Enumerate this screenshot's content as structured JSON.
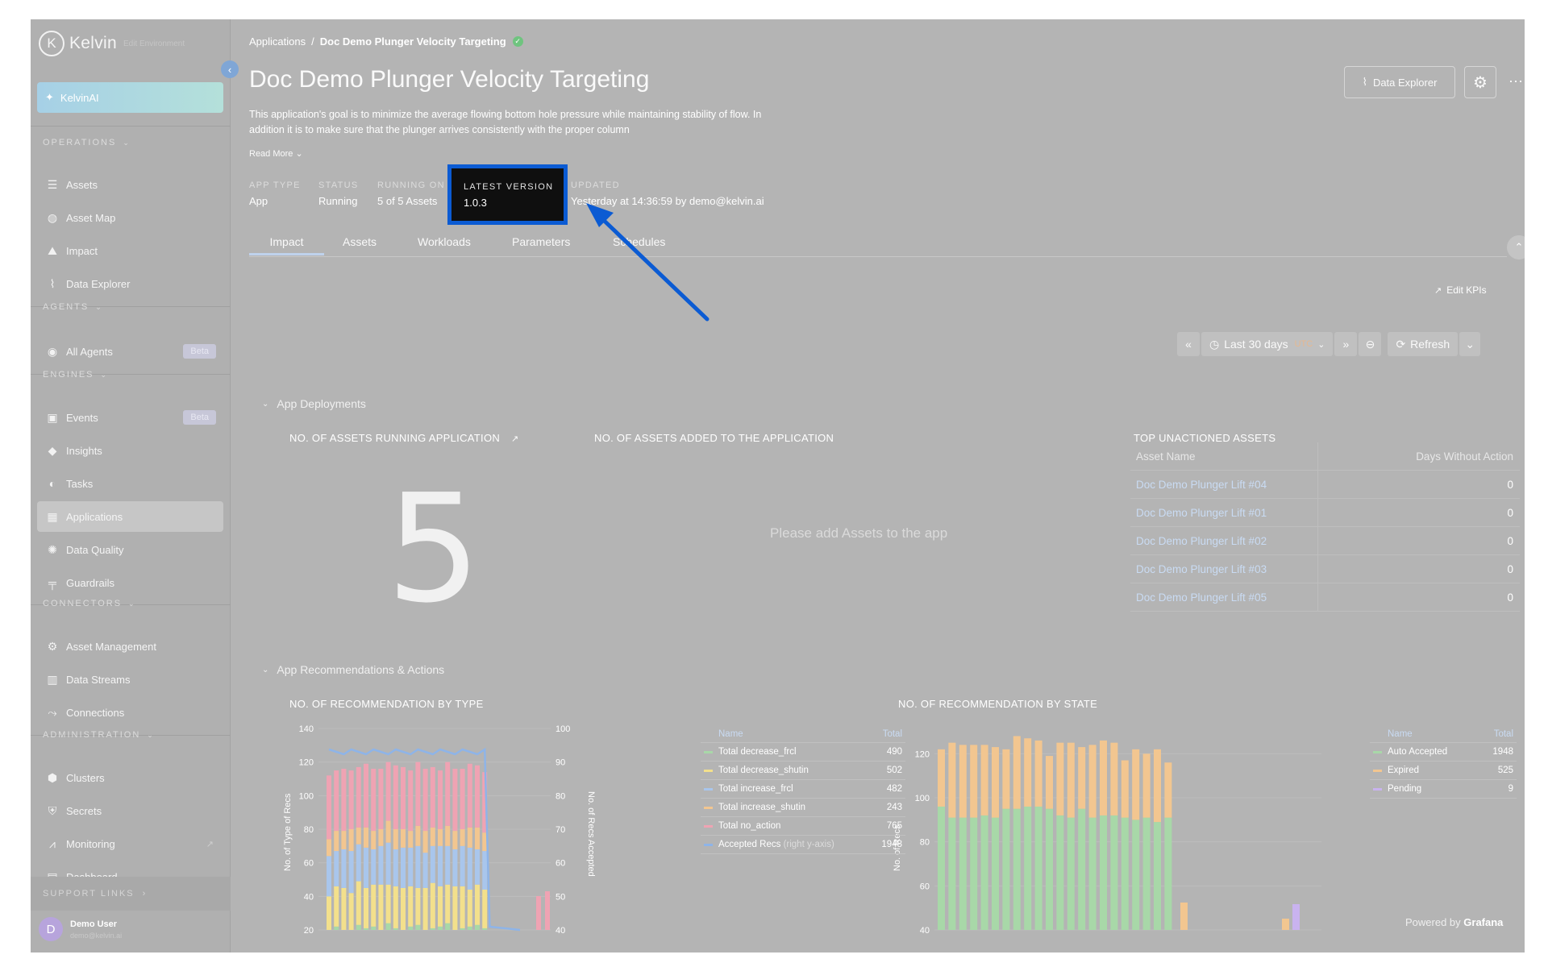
{
  "sidebar": {
    "brand": "Kelvin",
    "brand_sub": "Edit Environment",
    "kelvinai_label": "KelvinAI",
    "sections": {
      "operations": "OPERATIONS",
      "agents": "AGENTS",
      "engines": "ENGINES",
      "connectors": "CONNECTORS",
      "administration": "ADMINISTRATION"
    },
    "items": {
      "assets": "Assets",
      "asset_map": "Asset Map",
      "impact": "Impact",
      "data_explorer": "Data Explorer",
      "all_agents": "All Agents",
      "events": "Events",
      "insights": "Insights",
      "tasks": "Tasks",
      "applications": "Applications",
      "data_quality": "Data Quality",
      "guardrails": "Guardrails",
      "asset_management": "Asset Management",
      "data_streams": "Data Streams",
      "connections": "Connections",
      "clusters": "Clusters",
      "secrets": "Secrets",
      "monitoring": "Monitoring",
      "dashboard": "Dashboard"
    },
    "beta_label": "Beta",
    "support_links": "SUPPORT LINKS",
    "user": {
      "initial": "D",
      "name": "Demo User",
      "email": "demo@kelvin.ai"
    }
  },
  "header": {
    "breadcrumb_root": "Applications",
    "breadcrumb_current": "Doc Demo Plunger Velocity Targeting",
    "title": "Doc Demo Plunger Velocity Targeting",
    "description": "This application's goal is to minimize the average flowing bottom hole pressure while maintaining stability of flow. In addition it is to make sure that the plunger arrives consistently with the proper column",
    "read_more": "Read More",
    "data_explorer_button": "Data Explorer"
  },
  "meta": {
    "app_type_label": "APP TYPE",
    "app_type": "App",
    "status_label": "STATUS",
    "status": "Running",
    "running_on_label": "RUNNING ON",
    "running_on": "5 of 5 Assets",
    "latest_version_label": "LATEST VERSION",
    "latest_version": "1.0.3",
    "updated_label": "UPDATED",
    "updated": "Yesterday at 14:36:59 by demo@kelvin.ai"
  },
  "tabs": [
    "Impact",
    "Assets",
    "Workloads",
    "Parameters",
    "Schedules"
  ],
  "toolbar": {
    "edit_kpis": "Edit KPIs",
    "time_range": "Last 30 days",
    "timezone": "UTC",
    "refresh": "Refresh"
  },
  "dashboard": {
    "deployments_title": "App Deployments",
    "running_title": "NO. OF ASSETS RUNNING APPLICATION",
    "running_value": "5",
    "added_title": "NO. OF ASSETS ADDED TO THE APPLICATION",
    "added_empty": "Please add Assets to the app",
    "unactioned_title": "TOP UNACTIONED ASSETS",
    "unactioned_headers": [
      "Asset Name",
      "Days Without Action"
    ],
    "unactioned_rows": [
      {
        "name": "Doc Demo Plunger Lift #04",
        "days": "0"
      },
      {
        "name": "Doc Demo Plunger Lift #01",
        "days": "0"
      },
      {
        "name": "Doc Demo Plunger Lift #02",
        "days": "0"
      },
      {
        "name": "Doc Demo Plunger Lift #03",
        "days": "0"
      },
      {
        "name": "Doc Demo Plunger Lift #05",
        "days": "0"
      }
    ],
    "recs_title": "App Recommendations & Actions",
    "by_type_title": "NO. OF RECOMMENDATION BY TYPE",
    "by_state_title": "NO. OF RECOMMENDATION BY STATE",
    "legend_headers": [
      "Name",
      "Total"
    ],
    "powered_by": "Powered by",
    "grafana": "Grafana"
  },
  "chart_data": [
    {
      "type": "bar",
      "title": "NO. OF RECOMMENDATION BY TYPE",
      "ylabel": "No. of Type of Recs",
      "y2label": "No. of Recs Accepted",
      "ylim_visible": [
        20,
        140
      ],
      "y2lim_visible": [
        40,
        100
      ],
      "yticks": [
        20,
        40,
        60,
        80,
        100,
        120,
        140
      ],
      "y2ticks": [
        40,
        50,
        60,
        70,
        80,
        90,
        100
      ],
      "stacked": true,
      "series": [
        {
          "name": "Total decrease_frcl",
          "total": 490,
          "color": "#a8d8a8",
          "values": [
            18,
            22,
            20,
            19,
            23,
            21,
            22,
            20,
            24,
            21,
            19,
            22,
            23,
            20,
            21,
            22,
            24,
            20,
            21,
            22,
            23,
            21
          ]
        },
        {
          "name": "Total decrease_shutin",
          "total": 502,
          "color": "#f3e08c",
          "values": [
            22,
            24,
            25,
            23,
            26,
            24,
            25,
            27,
            23,
            25,
            26,
            24,
            22,
            25,
            27,
            24,
            23,
            26,
            25,
            22,
            24,
            23
          ]
        },
        {
          "name": "Total increase_frcl",
          "total": 482,
          "color": "#a9c6ec",
          "values": [
            24,
            21,
            23,
            25,
            22,
            24,
            21,
            23,
            25,
            22,
            24,
            23,
            25,
            21,
            22,
            24,
            23,
            22,
            24,
            25,
            21,
            23
          ]
        },
        {
          "name": "Total increase_shutin",
          "total": 243,
          "color": "#f2c690",
          "values": [
            10,
            12,
            11,
            13,
            10,
            12,
            11,
            10,
            13,
            12,
            11,
            10,
            12,
            13,
            11,
            10,
            12,
            11,
            10,
            12,
            13,
            11
          ]
        },
        {
          "name": "Total no_action",
          "total": 765,
          "color": "#efa3b3",
          "values": [
            38,
            36,
            37,
            35,
            36,
            38,
            37,
            36,
            35,
            38,
            37,
            36,
            38,
            37,
            36,
            35,
            38,
            37,
            36,
            38,
            37,
            36
          ]
        },
        {
          "name": "Accepted Recs",
          "legend_suffix": "(right y-axis)",
          "total": 1948,
          "color": "#8eb4e8"
        }
      ]
    },
    {
      "type": "bar",
      "title": "NO. OF RECOMMENDATION BY STATE",
      "ylabel": "No. of Recs",
      "ylim_visible": [
        40,
        130
      ],
      "yticks": [
        40,
        60,
        80,
        100,
        120
      ],
      "stacked": true,
      "series": [
        {
          "name": "Auto Accepted",
          "total": 1948,
          "color": "#a8d8a8",
          "values": [
            96,
            91,
            91,
            91,
            92,
            91,
            95,
            95,
            96,
            96,
            95,
            92,
            91,
            95,
            91,
            92,
            92,
            91,
            90,
            91,
            89,
            91
          ]
        },
        {
          "name": "Expired",
          "total": 525,
          "color": "#f2c690",
          "values": [
            26,
            34,
            33,
            33,
            32,
            32,
            27,
            33,
            31,
            30,
            24,
            33,
            34,
            28,
            33,
            34,
            33,
            26,
            32,
            29,
            33,
            25
          ]
        },
        {
          "name": "Pending",
          "total": 9,
          "color": "#c9b3ef"
        }
      ]
    }
  ]
}
